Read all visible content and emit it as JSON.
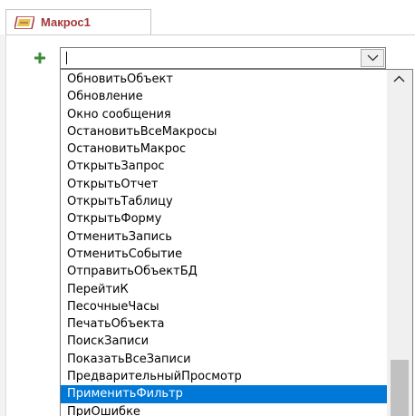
{
  "tab": {
    "title": "Макрос1"
  },
  "action_combo": {
    "value": ""
  },
  "dropdown": {
    "items": [
      "ОбновитьОбъект",
      "Обновление",
      "Окно сообщения",
      "ОстановитьВсеМакросы",
      "ОстановитьМакрос",
      "ОткрытьЗапрос",
      "ОткрытьОтчет",
      "ОткрытьТаблицу",
      "ОткрытьФорму",
      "ОтменитьЗапись",
      "ОтменитьСобытие",
      "ОтправитьОбъектБД",
      "ПерейтиК",
      "ПесочныеЧасы",
      "ПечатьОбъекта",
      "ПоискЗаписи",
      "ПоказатьВсеЗаписи",
      "ПредварительныйПросмотр",
      "ПрименитьФильтр",
      "ПриОшибке"
    ],
    "selected": "ПрименитьФильтр"
  },
  "icons": {
    "tab": "macro-icon",
    "add": "plus-icon",
    "dropdown_button": "chevron-down-icon",
    "scroll_up": "chevron-up-icon"
  },
  "colors": {
    "tab_title": "#a4373a",
    "selection": "#0078d7",
    "add_icon": "#3c8a3c"
  }
}
